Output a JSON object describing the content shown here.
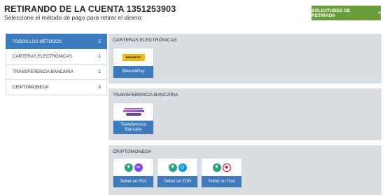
{
  "header": {
    "title": "RETIRANDO DE LA CUENTA 1351253903",
    "subtitle": "Seleccione el método de pago para retirar el dinero:",
    "requests_button": "SOLICITUDES DE RETIRADA",
    "requests_icon": "chevron-down-double-icon"
  },
  "sidebar": {
    "items": [
      {
        "label": "TODOS LOS MÉTODOS",
        "count": "5",
        "active": true
      },
      {
        "label": "CARTERAS ELECTRÓNICAS",
        "count": "1",
        "active": false
      },
      {
        "label": "TRANSFERENCIA BANCARIA",
        "count": "1",
        "active": false
      },
      {
        "label": "CRIPTOMONEDA",
        "count": "3",
        "active": false
      }
    ]
  },
  "sections": {
    "ewallets": {
      "title": "CARTERAS ELECTRÓNICAS",
      "cards": [
        {
          "label": "BinancePay",
          "logo_text": "BINANCE PAY"
        }
      ]
    },
    "bank": {
      "title": "TRANSFERENCIA BANCARIA",
      "cards": [
        {
          "label": "Transferencia Bancaria"
        }
      ]
    },
    "crypto": {
      "title": "CRIPTOMONEDA",
      "cards": [
        {
          "label": "Tether on POL",
          "icons": [
            "tether-icon",
            "polygon-icon"
          ]
        },
        {
          "label": "Tether on TON",
          "icons": [
            "tether-icon",
            "ton-icon"
          ]
        },
        {
          "label": "Tether on Tron",
          "icons": [
            "tether-icon",
            "tron-icon"
          ]
        }
      ]
    }
  },
  "colors": {
    "accent_blue": "#3d7bbd",
    "button_green": "#6a9c3a",
    "section_bg": "#d9dee3"
  }
}
